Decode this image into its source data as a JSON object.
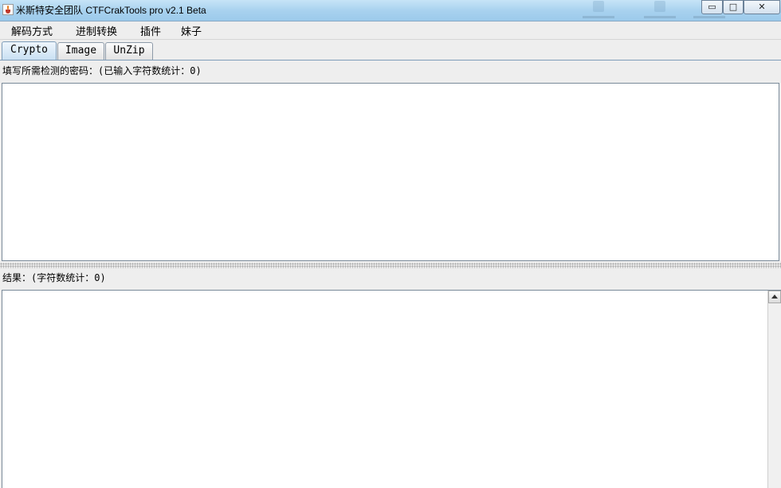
{
  "window": {
    "title": "米斯特安全团队 CTFCrakTools pro v2.1 Beta",
    "controls": [
      "▭",
      "□",
      "✕"
    ]
  },
  "menu": [
    {
      "label": "解码方式"
    },
    {
      "label": "进制转换"
    },
    {
      "label": "插件"
    },
    {
      "label": "妹子"
    }
  ],
  "tabs": [
    {
      "label": "Crypto",
      "active": true
    },
    {
      "label": "Image",
      "active": false
    },
    {
      "label": "UnZip",
      "active": false
    }
  ],
  "input_section": {
    "label": "填写所需检测的密码：(已输入字符数统计：0)",
    "value": ""
  },
  "output_section": {
    "label": "结果：(字符数统计：0)",
    "value": ""
  },
  "colors": {
    "titlebar": "#a9d2ef",
    "active_tab": "#c7dff2",
    "background": "#eeeeee"
  }
}
